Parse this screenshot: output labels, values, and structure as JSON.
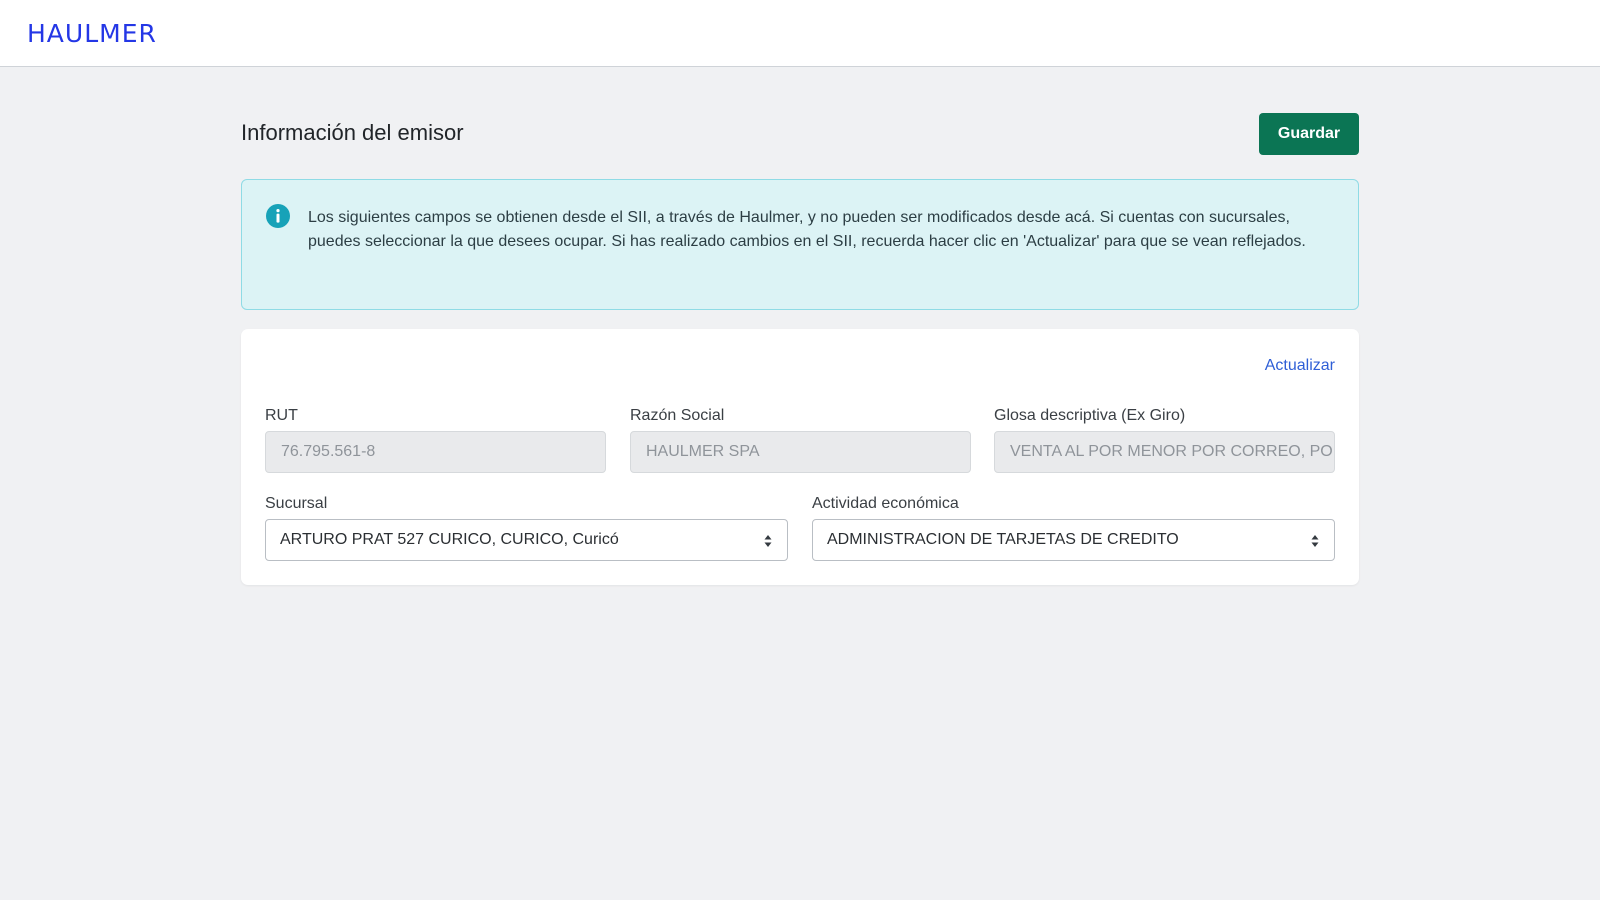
{
  "header": {
    "logo_text": "HAULMER"
  },
  "main": {
    "title": "Información del emisor",
    "save_label": "Guardar",
    "alert": {
      "icon": "info-icon",
      "color": "#17a2b8",
      "text": "Los siguientes campos se obtienen desde el SII, a través de Haulmer, y no pueden ser modificados desde acá. Si cuentas con sucursales, puedes seleccionar la que desees ocupar. Si has realizado cambios en el SII, recuerda hacer clic en 'Actualizar' para que se vean reflejados."
    },
    "card": {
      "refresh_label": "Actualizar",
      "rut": {
        "label": "RUT",
        "value": "76.795.561-8"
      },
      "razon_social": {
        "label": "Razón Social",
        "value": "HAULMER SPA"
      },
      "glosa": {
        "label": "Glosa descriptiva (Ex Giro)",
        "value": "VENTA AL POR MENOR POR CORREO, POR INTERNET Y VIA TELEFONICA"
      },
      "sucursal": {
        "label": "Sucursal",
        "value": "ARTURO PRAT 527 CURICO, CURICO, Curicó",
        "icon": "chevron-updown-icon"
      },
      "actividad": {
        "label": "Actividad económica",
        "value": "ADMINISTRACION DE TARJETAS DE CREDITO",
        "icon": "chevron-updown-icon"
      }
    }
  },
  "colors": {
    "brand": "#2437e6",
    "primary_button": "#0b7554",
    "link": "#2f5fd6",
    "alert_bg": "#dcf3f5"
  }
}
